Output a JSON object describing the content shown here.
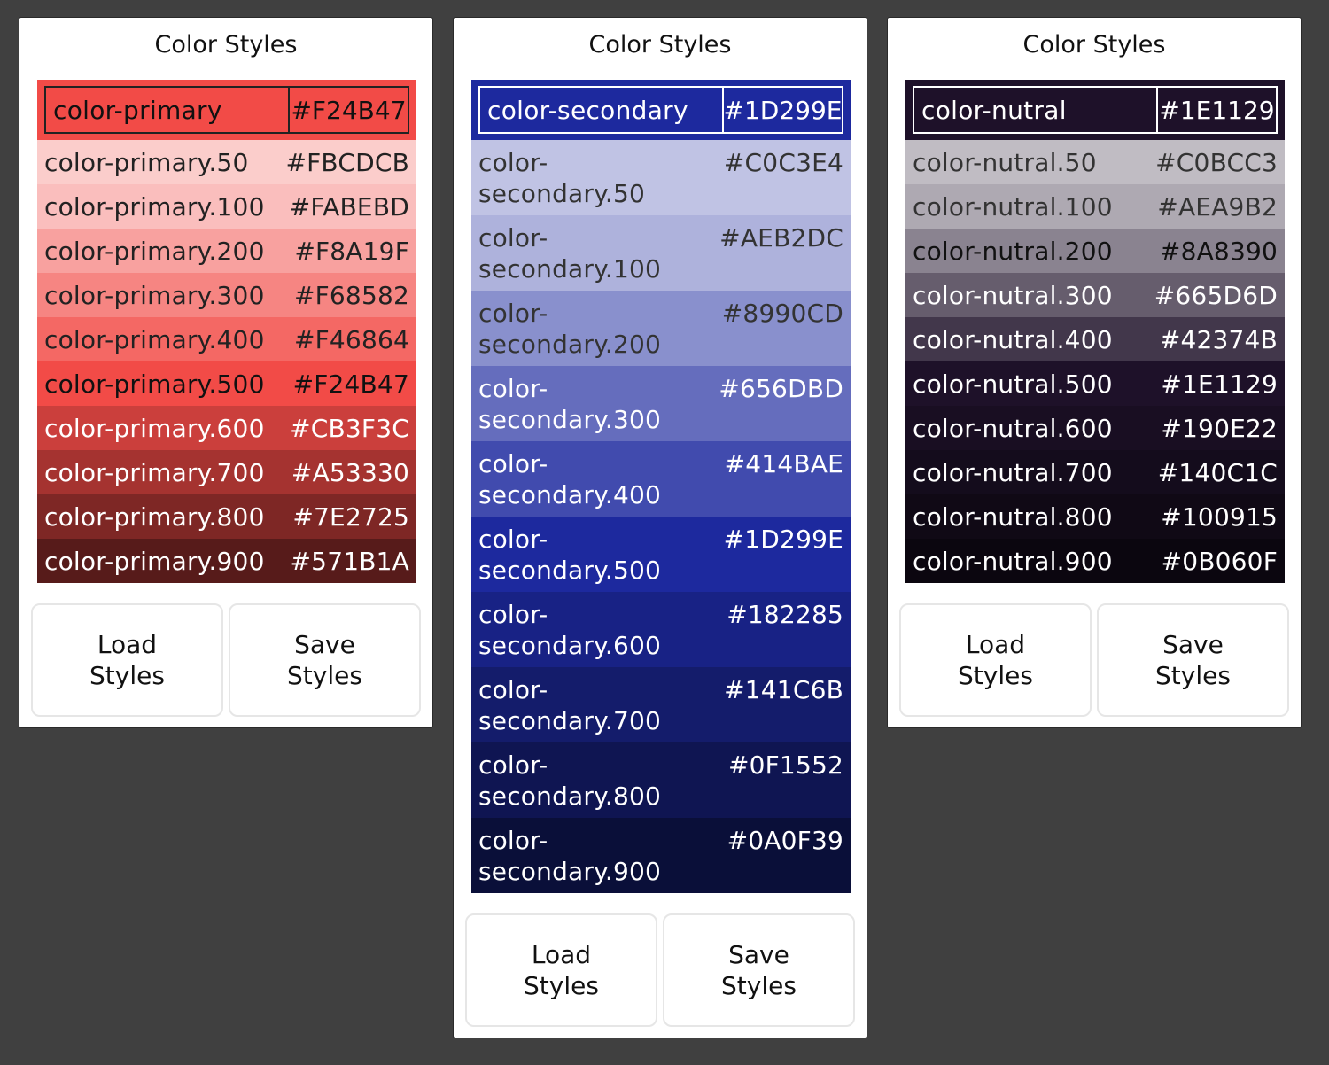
{
  "panels": [
    {
      "title": "Color Styles",
      "base": {
        "name": "color-primary",
        "hex": "#F24B47",
        "bg": "#F24B47",
        "text": "#111111",
        "border": "#222222"
      },
      "shades": [
        {
          "name": "color-primary.50",
          "hex": "#FBCDCB",
          "bg": "#FBCDCB",
          "text": "#222222"
        },
        {
          "name": "color-primary.100",
          "hex": "#FABEBD",
          "bg": "#FABEBD",
          "text": "#222222"
        },
        {
          "name": "color-primary.200",
          "hex": "#F8A19F",
          "bg": "#F8A19F",
          "text": "#222222"
        },
        {
          "name": "color-primary.300",
          "hex": "#F68582",
          "bg": "#F68582",
          "text": "#222222"
        },
        {
          "name": "color-primary.400",
          "hex": "#F46864",
          "bg": "#F46864",
          "text": "#222222"
        },
        {
          "name": "color-primary.500",
          "hex": "#F24B47",
          "bg": "#F24B47",
          "text": "#111111"
        },
        {
          "name": "color-primary.600",
          "hex": "#CB3F3C",
          "bg": "#CB3F3C",
          "text": "#ffffff"
        },
        {
          "name": "color-primary.700",
          "hex": "#A53330",
          "bg": "#A53330",
          "text": "#ffffff"
        },
        {
          "name": "color-primary.800",
          "hex": "#7E2725",
          "bg": "#7E2725",
          "text": "#ffffff"
        },
        {
          "name": "color-primary.900",
          "hex": "#571B1A",
          "bg": "#571B1A",
          "text": "#ffffff"
        }
      ],
      "load_label": "Load\nStyles",
      "save_label": "Save\nStyles"
    },
    {
      "title": "Color Styles",
      "base": {
        "name": "color-secondary",
        "hex": "#1D299E",
        "bg": "#1D299E",
        "text": "#ffffff",
        "border": "#ffffff"
      },
      "shades": [
        {
          "name": "color-secondary.50",
          "hex": "#C0C3E4",
          "bg": "#C0C3E4",
          "text": "#333333"
        },
        {
          "name": "color-secondary.100",
          "hex": "#AEB2DC",
          "bg": "#AEB2DC",
          "text": "#333333"
        },
        {
          "name": "color-secondary.200",
          "hex": "#8990CD",
          "bg": "#8990CD",
          "text": "#333333"
        },
        {
          "name": "color-secondary.300",
          "hex": "#656DBD",
          "bg": "#656DBD",
          "text": "#ffffff"
        },
        {
          "name": "color-secondary.400",
          "hex": "#414BAE",
          "bg": "#414BAE",
          "text": "#ffffff"
        },
        {
          "name": "color-secondary.500",
          "hex": "#1D299E",
          "bg": "#1D299E",
          "text": "#ffffff"
        },
        {
          "name": "color-secondary.600",
          "hex": "#182285",
          "bg": "#182285",
          "text": "#ffffff"
        },
        {
          "name": "color-secondary.700",
          "hex": "#141C6B",
          "bg": "#141C6B",
          "text": "#ffffff"
        },
        {
          "name": "color-secondary.800",
          "hex": "#0F1552",
          "bg": "#0F1552",
          "text": "#ffffff"
        },
        {
          "name": "color-secondary.900",
          "hex": "#0A0F39",
          "bg": "#0A0F39",
          "text": "#ffffff"
        }
      ],
      "load_label": "Load\nStyles",
      "save_label": "Save\nStyles"
    },
    {
      "title": "Color Styles",
      "base": {
        "name": "color-nutral",
        "hex": "#1E1129",
        "bg": "#1E1129",
        "text": "#ffffff",
        "border": "#ffffff"
      },
      "shades": [
        {
          "name": "color-nutral.50",
          "hex": "#C0BCC3",
          "bg": "#C0BCC3",
          "text": "#333333"
        },
        {
          "name": "color-nutral.100",
          "hex": "#AEA9B2",
          "bg": "#AEA9B2",
          "text": "#333333"
        },
        {
          "name": "color-nutral.200",
          "hex": "#8A8390",
          "bg": "#8A8390",
          "text": "#111111"
        },
        {
          "name": "color-nutral.300",
          "hex": "#665D6D",
          "bg": "#665D6D",
          "text": "#ffffff"
        },
        {
          "name": "color-nutral.400",
          "hex": "#42374B",
          "bg": "#42374B",
          "text": "#ffffff"
        },
        {
          "name": "color-nutral.500",
          "hex": "#1E1129",
          "bg": "#1E1129",
          "text": "#ffffff"
        },
        {
          "name": "color-nutral.600",
          "hex": "#190E22",
          "bg": "#190E22",
          "text": "#ffffff"
        },
        {
          "name": "color-nutral.700",
          "hex": "#140C1C",
          "bg": "#140C1C",
          "text": "#ffffff"
        },
        {
          "name": "color-nutral.800",
          "hex": "#100915",
          "bg": "#100915",
          "text": "#ffffff"
        },
        {
          "name": "color-nutral.900",
          "hex": "#0B060F",
          "bg": "#0B060F",
          "text": "#ffffff"
        }
      ],
      "load_label": "Load\nStyles",
      "save_label": "Save\nStyles"
    }
  ]
}
